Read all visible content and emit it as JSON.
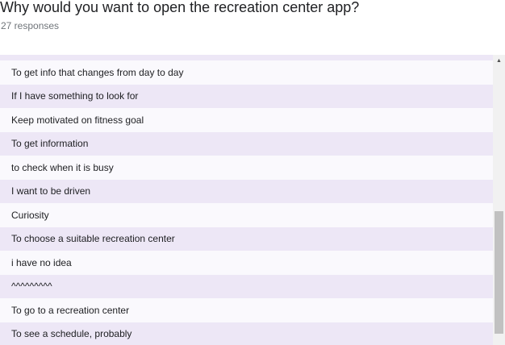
{
  "question": {
    "title": "Why would you want to open the recreation center app?",
    "response_count": "27 responses"
  },
  "responses": [
    "To get info that changes from day to day",
    "If I have something to look for",
    "Keep motivated on fitness goal",
    "To get information",
    "to check when it is busy",
    "I want to be driven",
    "Curiosity",
    "To choose a suitable recreation center",
    "i have no idea",
    "^^^^^^^^^",
    "To go to a recreation center",
    "To see a schedule, probably"
  ],
  "scrollbar": {
    "up_arrow_icon": "triangle-up"
  },
  "colors": {
    "stripe": "#ede7f6",
    "plain": "#faf9fd",
    "text": "#202124",
    "muted": "#70757a"
  }
}
